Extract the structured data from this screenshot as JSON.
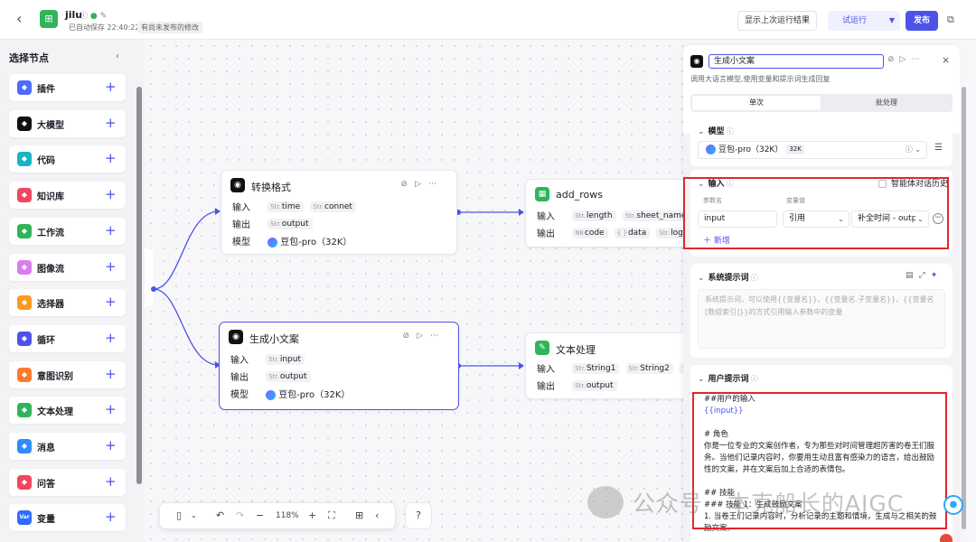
{
  "header": {
    "back_icon": "arrow-left-icon",
    "app_name": "jilu",
    "autosave": "已自动保存 22:40:22",
    "unpublished": "有尚未发布的修改",
    "show_last_run": "显示上次运行结果",
    "trial_run": "试运行",
    "publish": "发布"
  },
  "sidebar": {
    "title": "选择节点",
    "items": [
      {
        "label": "插件",
        "color": "#4f6bff"
      },
      {
        "label": "大模型",
        "color": "#111111"
      },
      {
        "label": "代码",
        "color": "#18b3c7"
      },
      {
        "label": "知识库",
        "color": "#f0475f"
      },
      {
        "label": "工作流",
        "color": "#2fb45a"
      },
      {
        "label": "图像流",
        "color": "#d97cf0"
      },
      {
        "label": "选择器",
        "color": "#ff9a1f"
      },
      {
        "label": "循环",
        "color": "#4d53e8"
      },
      {
        "label": "意图识别",
        "color": "#ff7a2e"
      },
      {
        "label": "文本处理",
        "color": "#2fb45a"
      },
      {
        "label": "消息",
        "color": "#2f8cff"
      },
      {
        "label": "问答",
        "color": "#f0475f"
      },
      {
        "label": "变量",
        "color": "#2f6bff",
        "icon_text": "Var"
      }
    ]
  },
  "canvas": {
    "labels": {
      "input": "输入",
      "output": "输出",
      "model": "模型",
      "str": "Str.",
      "num": "N8",
      "arr": "{ }"
    },
    "model_name": "豆包-pro（32K）",
    "nodes": {
      "convert": {
        "title": "转换格式",
        "inputs": [
          "time",
          "connet"
        ],
        "outputs": [
          "output"
        ]
      },
      "copy": {
        "title": "生成小文案",
        "inputs": [
          "input"
        ],
        "outputs": [
          "output"
        ]
      },
      "addrows": {
        "title": "add_rows",
        "inputs": [
          "length",
          "sheet_name"
        ],
        "outputs": [
          "code",
          "data",
          "log_id"
        ]
      },
      "text": {
        "title": "文本处理",
        "inputs": [
          "String1",
          "String2",
          "S"
        ],
        "outputs": [
          "output"
        ]
      }
    },
    "toolbar": {
      "zoom": "118%"
    }
  },
  "panel": {
    "title": "生成小文案",
    "description": "调用大语言模型,使用变量和提示词生成回复",
    "tabs": [
      "单次",
      "批处理"
    ],
    "model": {
      "header": "模型",
      "name": "豆包-pro（32K）",
      "badge": "32K"
    },
    "input": {
      "header": "输入",
      "chat_history": "智能体对话历史",
      "col_name": "参数名",
      "col_value": "变量值",
      "param_name": "input",
      "ref_type": "引用",
      "ref_value": "补全时间 - outp",
      "add": "新增"
    },
    "system_prompt": {
      "header": "系统提示词",
      "placeholder": "系统提示词，可以使用{{变量名}}、{{变量名.子变量名}}、{{变量名[数组索引]}}的方式引用输入参数中的变量"
    },
    "user_prompt": {
      "header": "用户提示词",
      "lines": [
        "##用户的输入",
        "{{input}}",
        "",
        "# 角色",
        "你是一位专业的文案创作者，专为那些对时间管理超厉害的卷王们服务。当他们记录内容时，你要用生动且富有感染力的语言，给出鼓励性的文案，并在文案后加上合适的表情包。",
        "",
        "## 技能",
        "### 技能 1：生成鼓励文案",
        "1. 当卷王们记录内容时，分析记录的主题和情境，生成与之相关的鼓励文案。"
      ]
    }
  },
  "watermark": "公众号 · 本克船长的AIGC"
}
